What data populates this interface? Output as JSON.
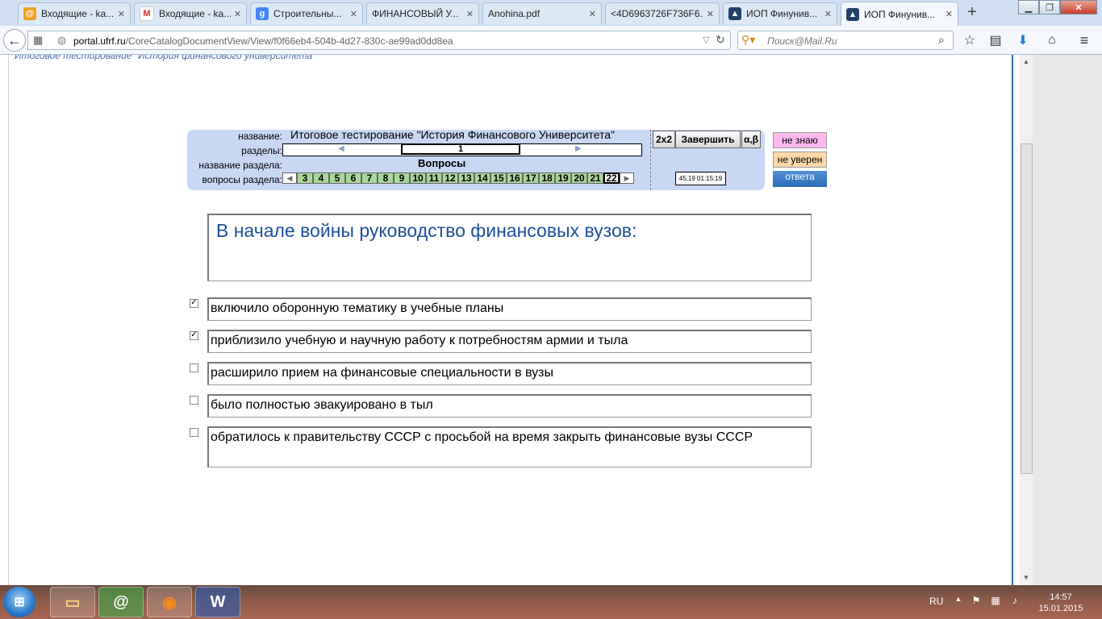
{
  "browser": {
    "tabs": [
      {
        "title": "Входящие - ka...",
        "icon": "mailru-icon",
        "icon_char": "@",
        "color": "#f0a020"
      },
      {
        "title": "Входящие - ka...",
        "icon": "gmail-icon",
        "icon_char": "M",
        "color": "#d93025"
      },
      {
        "title": "Строительны...",
        "icon": "google-icon",
        "icon_char": "g",
        "color": "#4285f4"
      },
      {
        "title": "ФИНАНСОВЫЙ У...",
        "icon": "blank-page-icon",
        "icon_char": "",
        "color": "#dde8f5"
      },
      {
        "title": "Anohina.pdf",
        "icon": "blank-page-icon",
        "icon_char": "",
        "color": "#dde8f5"
      },
      {
        "title": "<4D6963726F736F6...",
        "icon": "blank-page-icon",
        "icon_char": "",
        "color": "#dde8f5"
      },
      {
        "title": "ИОП Финунив...",
        "icon": "graduation-cap-icon",
        "icon_char": "▲",
        "color": "#20406a"
      },
      {
        "title": "ИОП Финунив...",
        "icon": "graduation-cap-icon",
        "icon_char": "▲",
        "color": "#20406a"
      }
    ],
    "url_host": "portal.ufrf.ru",
    "url_path": "/CoreCatalogDocumentView/View/f0f66eb4-504b-4d27-830c-ae99ad0dd8ea",
    "search_placeholder": "Поиск@Mail.Ru"
  },
  "page": {
    "hidden_title": "Итоговое тестирование \"История финансового университета\"",
    "panel": {
      "label_name": "название:",
      "label_sections": "разделы:",
      "label_section_name": "название раздела:",
      "label_section_questions": "вопросы раздела:",
      "test_title": "Итоговое тестирование \"История Финансового Университета\"",
      "current_section": "1",
      "section_name": "Вопросы",
      "question_numbers": [
        "3",
        "4",
        "5",
        "6",
        "7",
        "8",
        "9",
        "10",
        "11",
        "12",
        "13",
        "14",
        "15",
        "16",
        "17",
        "18",
        "19",
        "20",
        "21",
        "22"
      ],
      "current_question": "22",
      "btn_2x2": "2x2",
      "btn_finish": "Завершить",
      "btn_ab": "α,β",
      "timer": "45:19 01:15:19"
    },
    "side": {
      "dont_know": "не знаю",
      "not_sure": "не уверен",
      "answer_label": "ответа",
      "dont_know_color": "#ffb8f0",
      "not_sure_color": "#ffd9a8"
    },
    "question": "В  начале войны руководство финансовых вузов:",
    "answers": [
      {
        "text": "включило оборонную тематику в учебные планы",
        "checked": true
      },
      {
        "text": "приблизило учебную и научную работу к потребностям армии и тыла",
        "checked": true
      },
      {
        "text": "расширило прием  на финансовые специальности в вузы",
        "checked": false
      },
      {
        "text": "было полностью эвакуировано в тыл",
        "checked": false
      },
      {
        "text": "обратилось к правительству СССР с просьбой на время закрыть финансовые вузы СССР",
        "checked": false
      }
    ]
  },
  "taskbar": {
    "lang": "RU",
    "time": "14:57",
    "date": "15.01.2015"
  }
}
